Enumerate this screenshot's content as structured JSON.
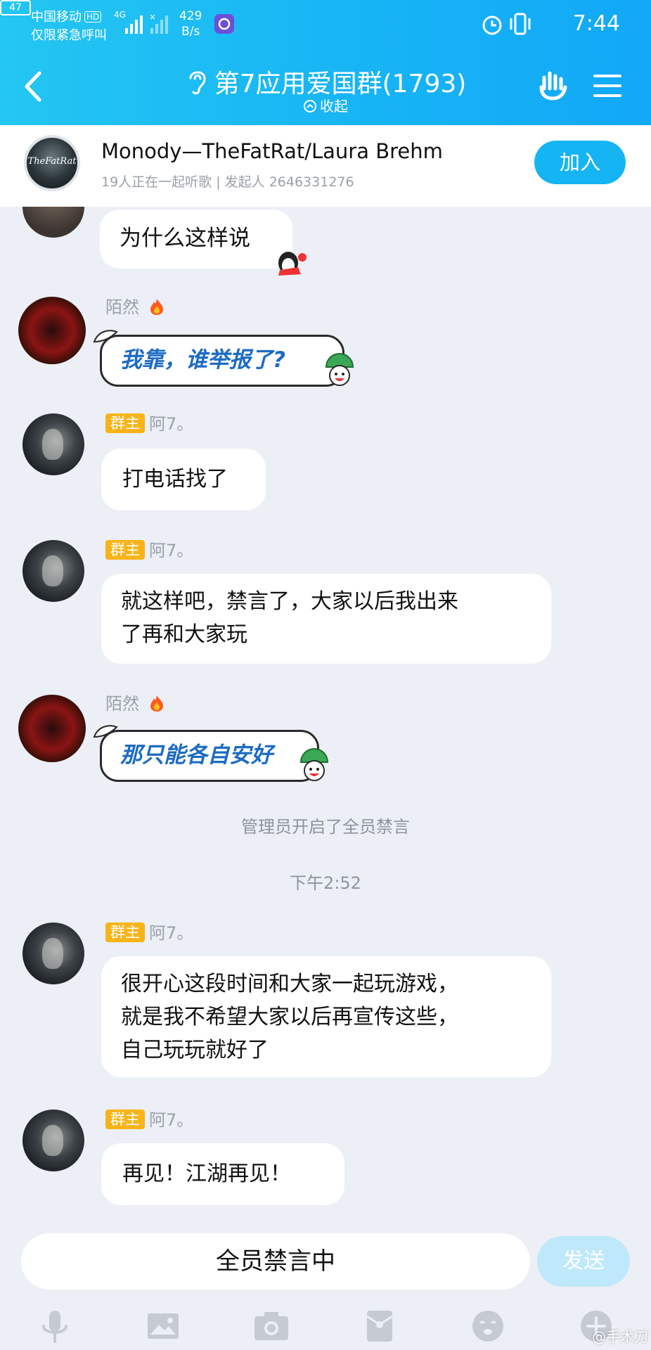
{
  "status_bar": {
    "carrier": "中国移动",
    "hd": "HD",
    "emergency": "仅限紧急呼叫",
    "network": "4G",
    "speed_value": "429",
    "speed_unit": "B/s",
    "battery": "47",
    "time": "7:44"
  },
  "header": {
    "title": "第7应用爱国群(1793)",
    "collapse_label": "收起"
  },
  "listen_banner": {
    "album_text": "TheFatRat",
    "song_title": "Monody—TheFatRat/Laura Brehm",
    "subtitle": "19人正在一起听歌 | 发起人 2646331276",
    "join_label": "加入"
  },
  "messages": [
    {
      "sender": "",
      "badge": "",
      "text": "为什么这样说",
      "style": "plain"
    },
    {
      "sender": "陌然",
      "badge": "",
      "text": "我靠，谁举报了?",
      "style": "blue"
    },
    {
      "sender": "阿7。",
      "badge": "群主",
      "text": "打电话找了",
      "style": "hand"
    },
    {
      "sender": "阿7。",
      "badge": "群主",
      "lines": [
        "就这样吧，禁言了，大家以后我出来",
        "了再和大家玩"
      ],
      "style": "hand"
    },
    {
      "sender": "陌然",
      "badge": "",
      "text": "那只能各自安好",
      "style": "blue"
    },
    {
      "sender": "阿7。",
      "badge": "群主",
      "lines": [
        "很开心这段时间和大家一起玩游戏，",
        "就是我不希望大家以后再宣传这些，",
        "自己玩玩就好了"
      ],
      "style": "hand"
    },
    {
      "sender": "阿7。",
      "badge": "群主",
      "text": "再见！江湖再见！",
      "style": "hand"
    }
  ],
  "system": {
    "mute_notice": "管理员开启了全员禁言",
    "timestamp": "下午2:52"
  },
  "input_bar": {
    "muted_text": "全员禁言中",
    "send_label": "发送",
    "tools": [
      "microphone-icon",
      "image-icon",
      "camera-icon",
      "red-packet-icon",
      "emoji-icon",
      "plus-icon"
    ]
  },
  "watermark": "@手术刀",
  "colors": {
    "header_start": "#24c6f2",
    "header_end": "#12a8f7",
    "owner_badge": "#f7b419",
    "blue_text": "#1c6bc4",
    "background": "#eceff6"
  }
}
